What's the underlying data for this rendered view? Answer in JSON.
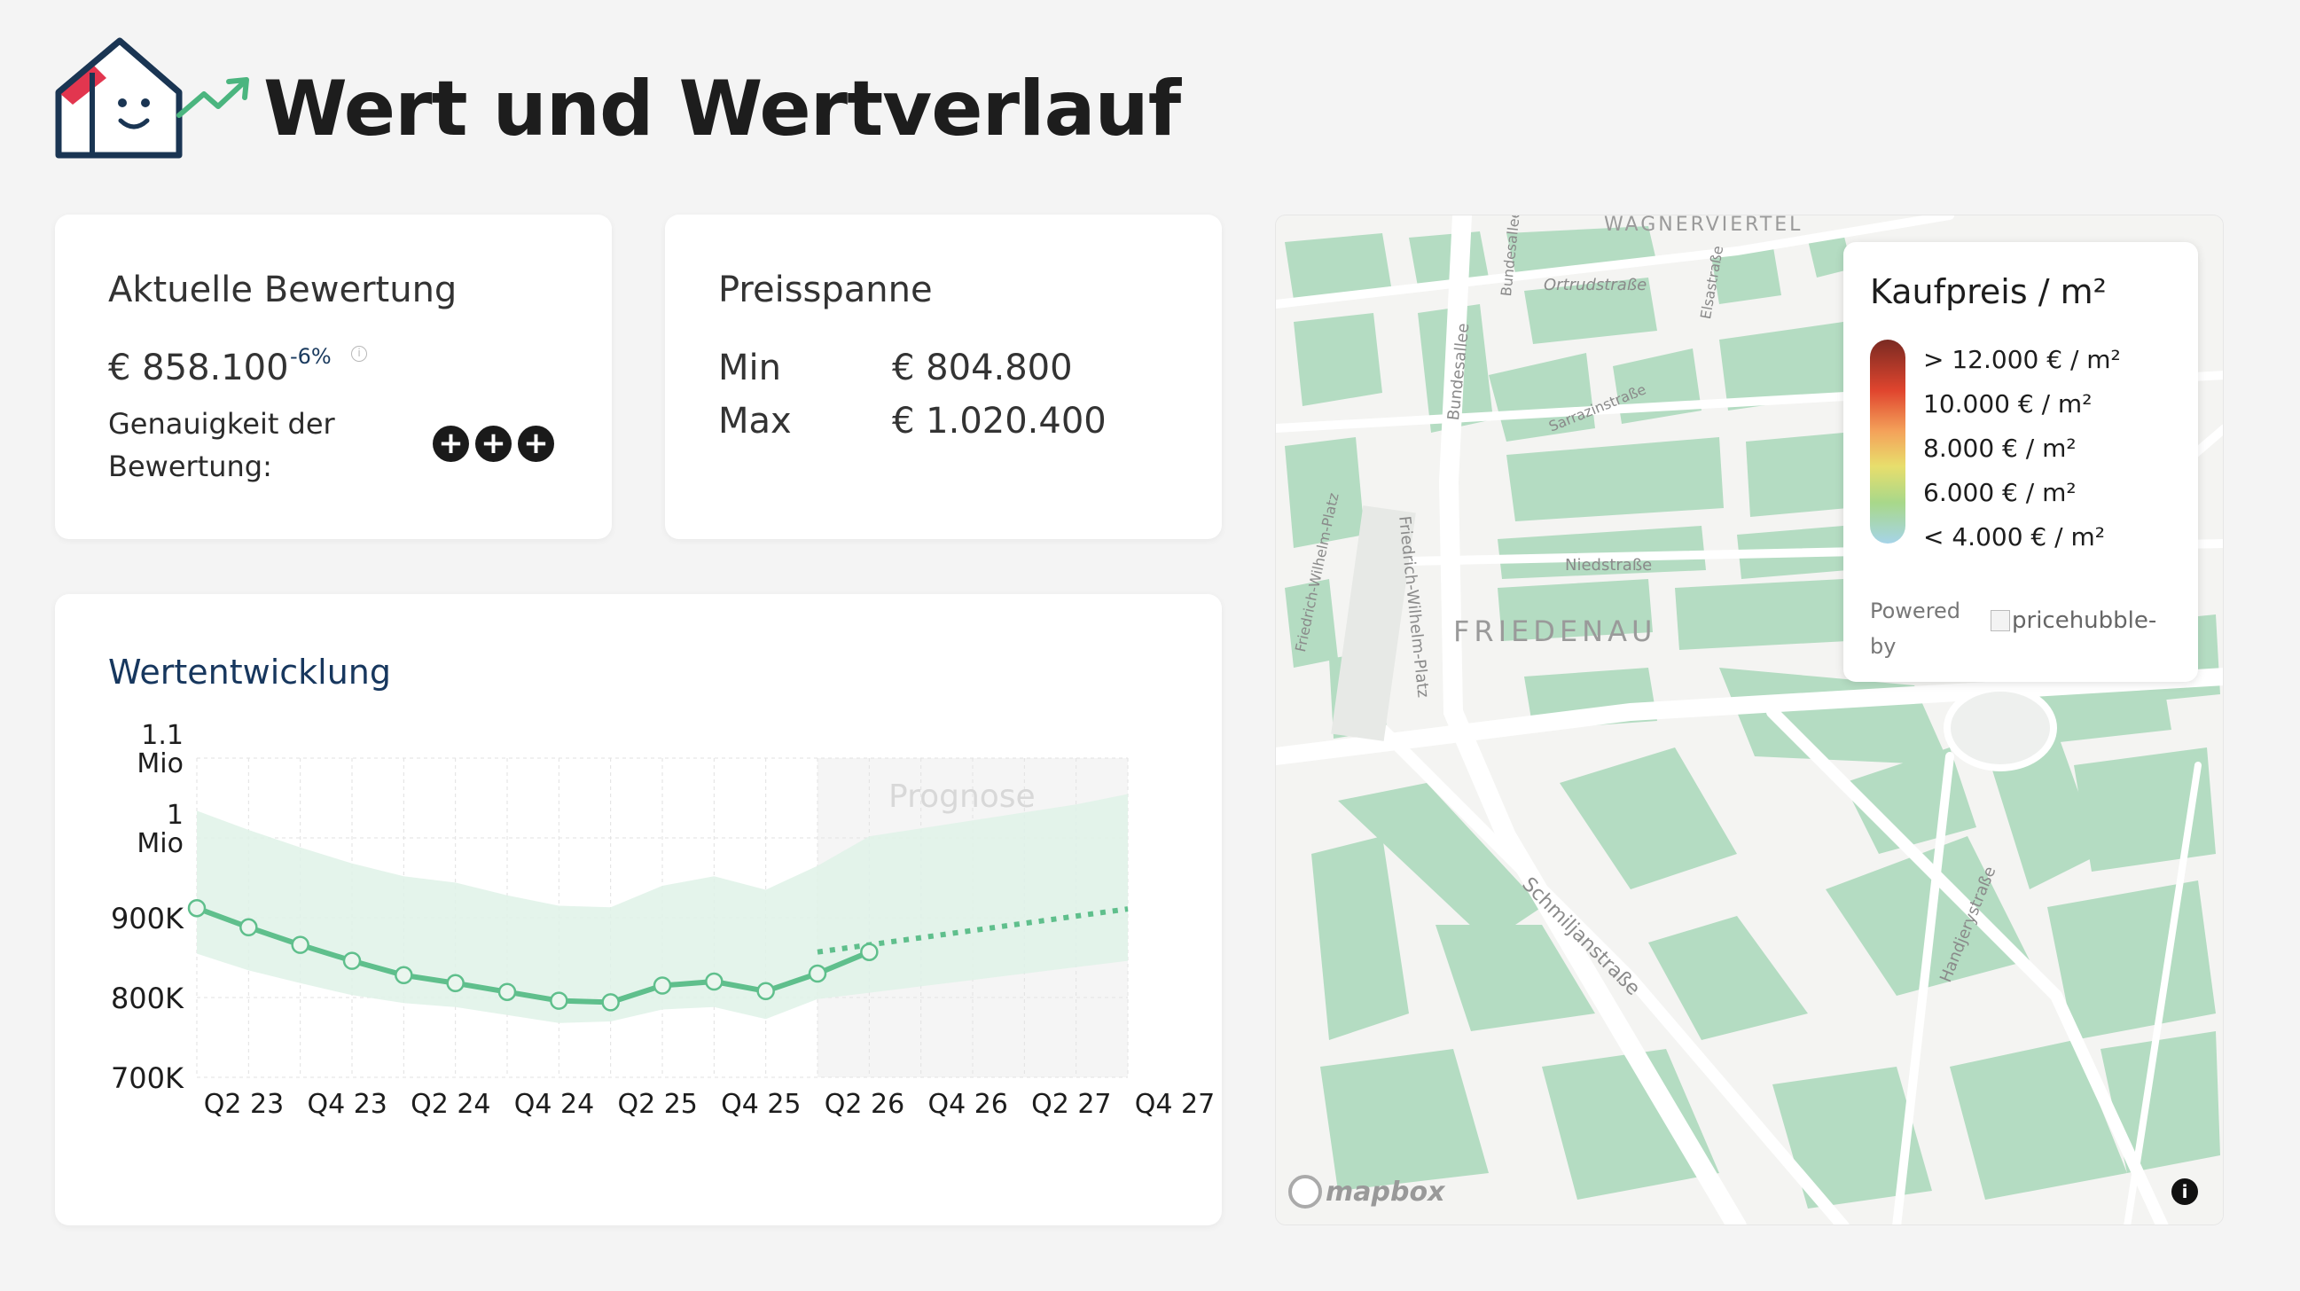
{
  "header": {
    "title": "Wert und Wertverlauf"
  },
  "valuation": {
    "heading": "Aktuelle Bewertung",
    "price": "€ 858.100",
    "change": "-6%",
    "info": "i",
    "accuracy_label": "Genauigkeit der Bewertung:",
    "accuracy_symbol": "+",
    "accuracy_level": 3
  },
  "range": {
    "heading": "Preisspanne",
    "min_label": "Min",
    "min_value": "€ 804.800",
    "max_label": "Max",
    "max_value": "€ 1.020.400"
  },
  "chart": {
    "title": "Wertentwicklung",
    "prognosis_label": "Prognose"
  },
  "chart_data": {
    "type": "line",
    "x_ticks": [
      "Q2 23",
      "Q4 23",
      "Q2 24",
      "Q4 24",
      "Q2 25",
      "Q4 25",
      "Q2 26",
      "Q4 26",
      "Q2 27",
      "Q4 27"
    ],
    "y_ticks": [
      {
        "value": 700000,
        "label": "700K"
      },
      {
        "value": 800000,
        "label": "800K"
      },
      {
        "value": 900000,
        "label": "900K"
      },
      {
        "value": 1000000,
        "label": "1 Mio"
      },
      {
        "value": 1100000,
        "label": "1.1 Mio"
      }
    ],
    "ylim": [
      700000,
      1100000
    ],
    "quarters_index": [
      "Q2 23",
      "Q3 23",
      "Q4 23",
      "Q1 24",
      "Q2 24",
      "Q3 24",
      "Q4 24",
      "Q1 25",
      "Q2 25",
      "Q3 25",
      "Q4 25",
      "Q1 26",
      "Q2 26",
      "Q3 26",
      "Q4 26",
      "Q1 27",
      "Q2 27",
      "Q3 27",
      "Q4 27"
    ],
    "series": [
      {
        "values": [
          912000,
          888000,
          866000,
          846000,
          828000,
          818000,
          807000,
          796000,
          794000,
          815000,
          820000,
          808000,
          830000,
          857000
        ]
      }
    ],
    "forecast": {
      "from": "Q2 26",
      "to": "Q4 27",
      "start_value": 857000,
      "end_value": 911000
    },
    "band_upper": [
      1034000,
      1010000,
      988000,
      968000,
      952000,
      944000,
      928000,
      915000,
      913000,
      940000,
      952000,
      935000,
      965000,
      1002000,
      1012000,
      1022000,
      1032000,
      1042000,
      1055000
    ],
    "band_lower": [
      855000,
      834000,
      818000,
      803000,
      793000,
      788000,
      778000,
      768000,
      770000,
      785000,
      788000,
      773000,
      798000,
      806000,
      814000,
      822000,
      830000,
      838000,
      846000
    ],
    "prognosis_from": "Q2 26",
    "grid": true,
    "colors": {
      "line": "#5fbf8c",
      "band": "#dff2e7",
      "forecast_bg": "#eeeeee"
    }
  },
  "map": {
    "legend_title": "Kaufpreis / m²",
    "legend_items": [
      "> 12.000 € / m²",
      "10.000 € / m²",
      "8.000 € / m²",
      "6.000 € / m²",
      "< 4.000 € / m²"
    ],
    "powered_by": "Powered by",
    "brand_alt": "pricehubble-",
    "attribution": "mapbox",
    "info": "i",
    "district": "FRIEDENAU",
    "streets": {
      "wagnerviertel": "WAGNERVIERTEL",
      "ortrud": "Ortrudstraße",
      "bundesallee_top": "Bundesallee",
      "elsass": "Elsastraße",
      "bundesallee": "Bundesallee",
      "sarrazin": "Sarrazinstraße",
      "fwp_left": "Friedrich-Wilhelm-Platz",
      "fwp_right": "Friedrich-Wilhelm-Platz",
      "niedstrasse": "Niedstraße",
      "schmiljan": "Schmiljanstraße",
      "handjery": "Handjerystraße",
      "edge": "allee"
    },
    "colors": {
      "buildings": "#b4dcc2",
      "roads": "#ffffff",
      "base": "#f4f4f2"
    }
  }
}
